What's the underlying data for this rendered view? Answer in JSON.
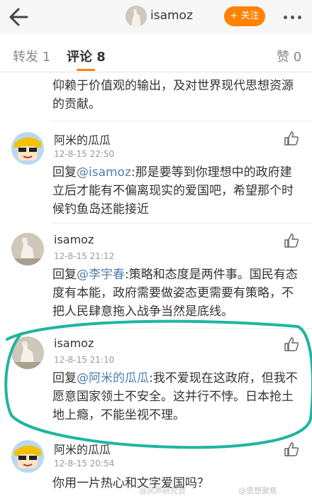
{
  "header": {
    "back_icon": "back-arrow-icon",
    "username": "isamoz",
    "follow_label": "+ 关注",
    "more_icon": "more-dots-icon",
    "accent": "#ff8200"
  },
  "tabs": {
    "repost": "转发 1",
    "comments": "评论 8",
    "likes": "赞 0"
  },
  "prev_comment_text": "仰赖于价值观的输出，及对世界现代思想资源的贡献。",
  "comments": [
    {
      "name": "阿米的瓜瓜",
      "time": "12-8-15 22:50",
      "prefix": "回复",
      "mention": "@isamoz",
      "text": ":那是要等到你理想中的政府建立后才能有不偏离现实的爱国吧，希望那个时候钓鱼岛还能接近"
    },
    {
      "name": "isamoz",
      "time": "12-8-15 21:12",
      "prefix": "回复",
      "mention": "@李宇春",
      "text": ":策略和态度是两件事。国民有态度有本能，政府需要做姿态更需要有策略，不把人民肆意拖入战争当然是底线。"
    },
    {
      "name": "isamoz",
      "time": "12-8-15 21:10",
      "prefix": "回复",
      "mention": "@阿米的瓜瓜",
      "text": ":我不爱现在这政府，但我不愿意国家领土不安全。这并行不悖。日本抢土地上瘾，不能坐视不理。"
    },
    {
      "name": "阿米的瓜瓜",
      "time": "12-8-15 20:54",
      "text": "你用一片热心和文字爱国吗？"
    }
  ],
  "like_icon": "thumbs-up-icon",
  "mention_color": "#507daf",
  "annotation_color": "#1fb5a0",
  "watermarks": {
    "left": "@风声研究会",
    "right": "@思想聚焦"
  }
}
